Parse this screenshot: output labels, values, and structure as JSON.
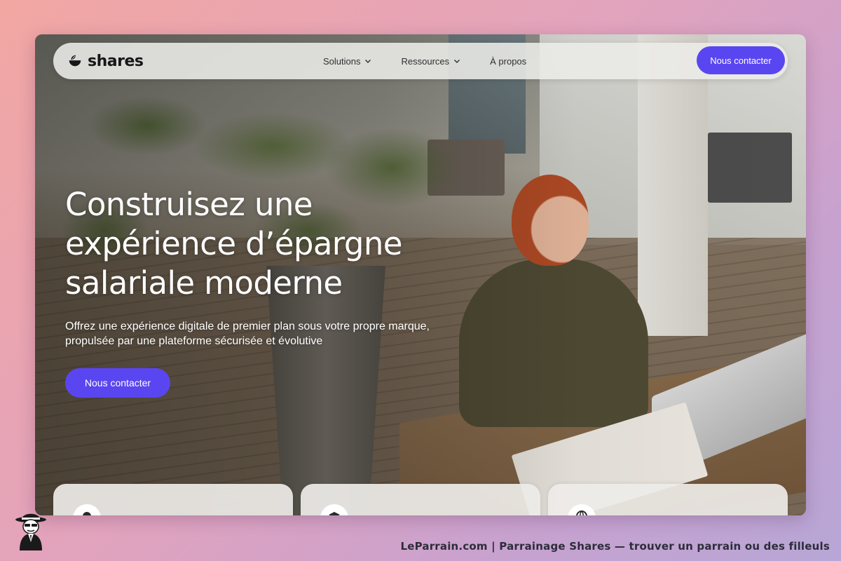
{
  "brand": {
    "name": "shares",
    "logo_icon": "leaf-bowl-icon",
    "accent": "#5a46f0"
  },
  "nav": {
    "items": [
      {
        "label": "Solutions",
        "has_dropdown": true
      },
      {
        "label": "Ressources",
        "has_dropdown": true
      },
      {
        "label": "À propos",
        "has_dropdown": false
      }
    ],
    "cta_label": "Nous contacter"
  },
  "hero": {
    "title": "Construisez une expérience d’épargne salariale moderne",
    "subtitle": "Offrez une expérience digitale de premier plan sous votre propre marque, propulsée par une plateforme sécurisée et évolutive",
    "cta_label": "Nous contacter"
  },
  "cards": [
    {
      "icon": "circle-icon"
    },
    {
      "icon": "graduation-cap-icon"
    },
    {
      "icon": "globe-icon"
    }
  ],
  "footer": {
    "mascot_icon": "godfather-mascot-icon",
    "credit": "LeParrain.com | Parrainage Shares — trouver un parrain ou des filleuls"
  }
}
